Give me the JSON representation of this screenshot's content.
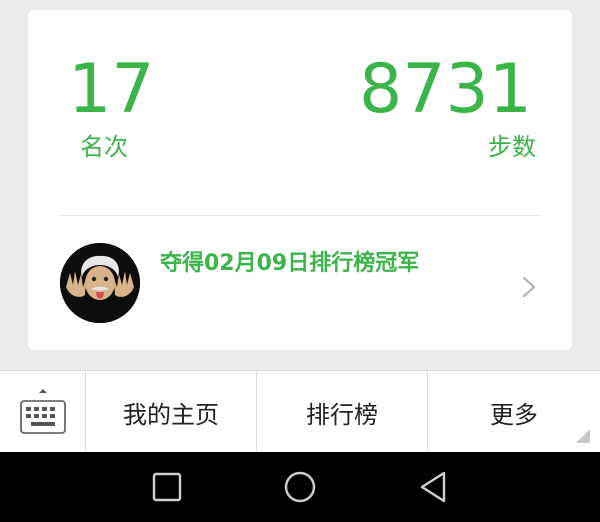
{
  "colors": {
    "accent": "#3bb54a",
    "card_bg": "#ffffff",
    "page_bg": "#ebebeb",
    "nav_bg": "#000000"
  },
  "stats": {
    "rank": {
      "value": "17",
      "label": "名次"
    },
    "steps": {
      "value": "8731",
      "label": "步数"
    }
  },
  "champion": {
    "text": "夺得02月09日排行榜冠军",
    "avatar_icon": "einstein-avatar"
  },
  "tabbar": {
    "keyboard_icon": "keyboard-icon",
    "tabs": [
      {
        "label": "我的主页"
      },
      {
        "label": "排行榜"
      },
      {
        "label": "更多"
      }
    ]
  },
  "navbar": {
    "buttons": [
      "recent-apps-icon",
      "home-icon",
      "back-icon"
    ]
  }
}
